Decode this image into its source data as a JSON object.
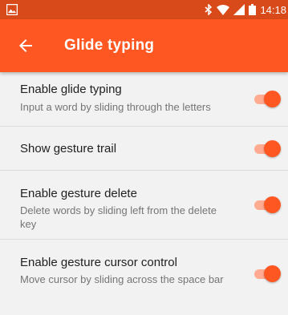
{
  "status_bar": {
    "time": "14:18",
    "icons": [
      "image-icon",
      "bluetooth-icon",
      "wifi-icon",
      "signal-icon",
      "battery-icon"
    ]
  },
  "toolbar": {
    "title": "Glide typing",
    "back_icon": "arrow-back-icon"
  },
  "settings": [
    {
      "title": "Enable glide typing",
      "summary": "Input a word by sliding through the letters",
      "enabled": true
    },
    {
      "title": "Show gesture trail",
      "summary": "",
      "enabled": true
    },
    {
      "title": "Enable gesture delete",
      "summary": "Delete words by sliding left from the delete key",
      "enabled": true
    },
    {
      "title": "Enable gesture cursor control",
      "summary": "Move cursor by sliding across the space bar",
      "enabled": true
    }
  ],
  "colors": {
    "accent": "#ff5722",
    "status_bar": "#d94a1a",
    "switch_track": "#ffab91",
    "background": "#f2f2f2"
  }
}
